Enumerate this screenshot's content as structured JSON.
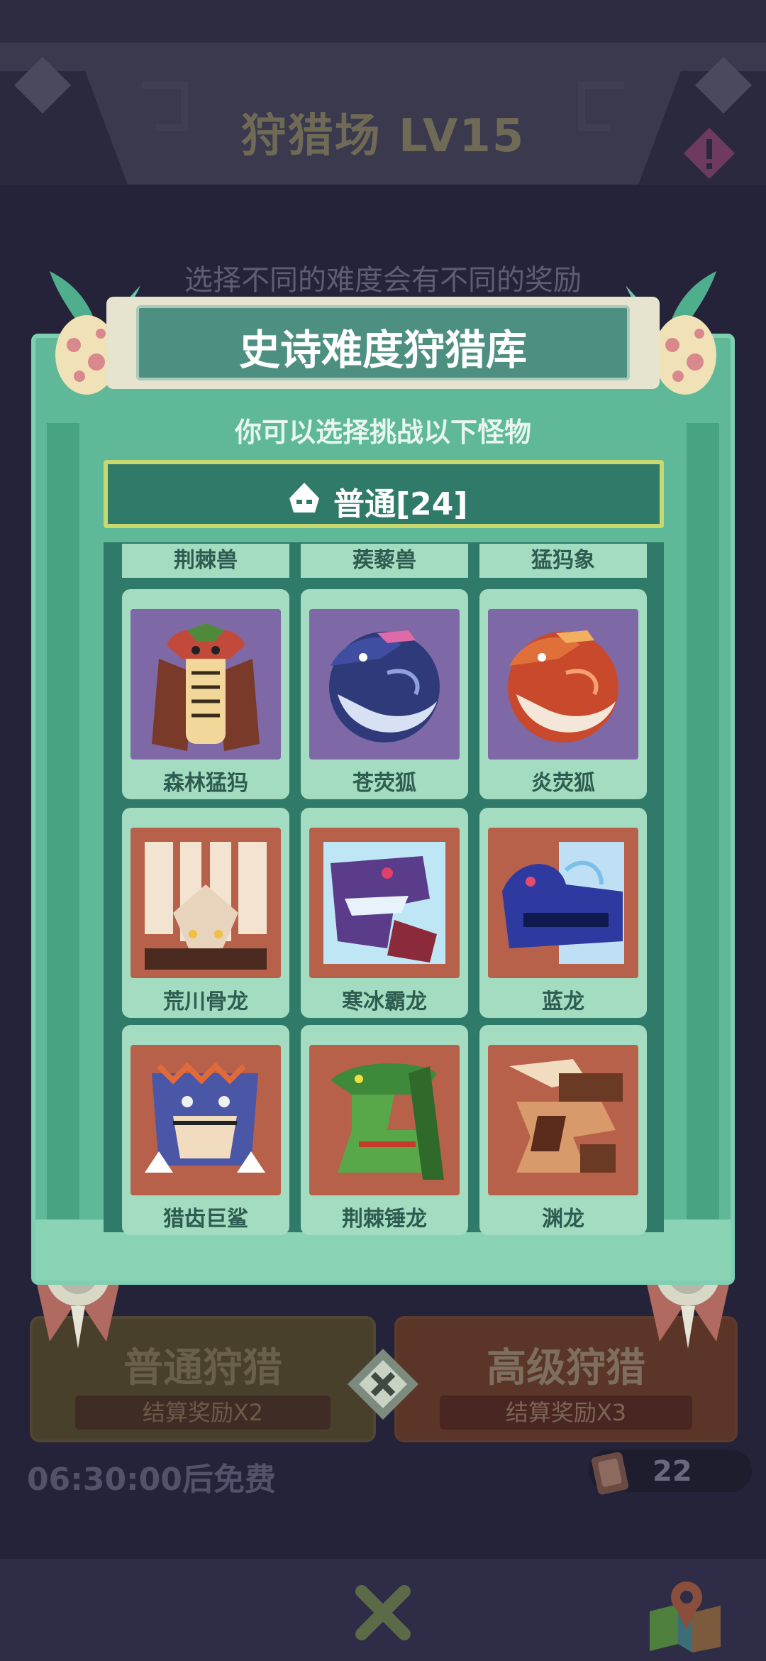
{
  "header": {
    "title": "狩猎场 LV15"
  },
  "hint": "选择不同的难度会有不同的奖励",
  "panel": {
    "title": "史诗难度狩猎库",
    "subtitle": "你可以选择挑战以下怪物",
    "category": "普通[24]"
  },
  "monsters_partial_row": [
    "荆棘兽",
    "蒺藜兽",
    "猛犸象"
  ],
  "monsters": [
    {
      "name": "森林猛犸",
      "bg": "purple"
    },
    {
      "name": "苍荧狐",
      "bg": "purple"
    },
    {
      "name": "炎荧狐",
      "bg": "purple"
    },
    {
      "name": "荒川骨龙",
      "bg": "brown"
    },
    {
      "name": "寒冰霸龙",
      "bg": "brown"
    },
    {
      "name": "蓝龙",
      "bg": "brown"
    },
    {
      "name": "猎齿巨鲨",
      "bg": "brown"
    },
    {
      "name": "荆棘锤龙",
      "bg": "brown"
    },
    {
      "name": "渊龙",
      "bg": "brown"
    }
  ],
  "buttons": {
    "normal_hunt": {
      "label": "普通狩猎",
      "reward": "结算奖励X2"
    },
    "advanced_hunt": {
      "label": "高级狩猎",
      "reward": "结算奖励X3"
    }
  },
  "footer": {
    "free_timer": "06:30:00后免费",
    "ticket_count": "22"
  },
  "colors": {
    "panel_green": "#5fb898",
    "panel_dark": "#2f7a68",
    "card_purple": "#7e68a6",
    "card_brown": "#b8614a",
    "category_border": "#c6d86e"
  }
}
